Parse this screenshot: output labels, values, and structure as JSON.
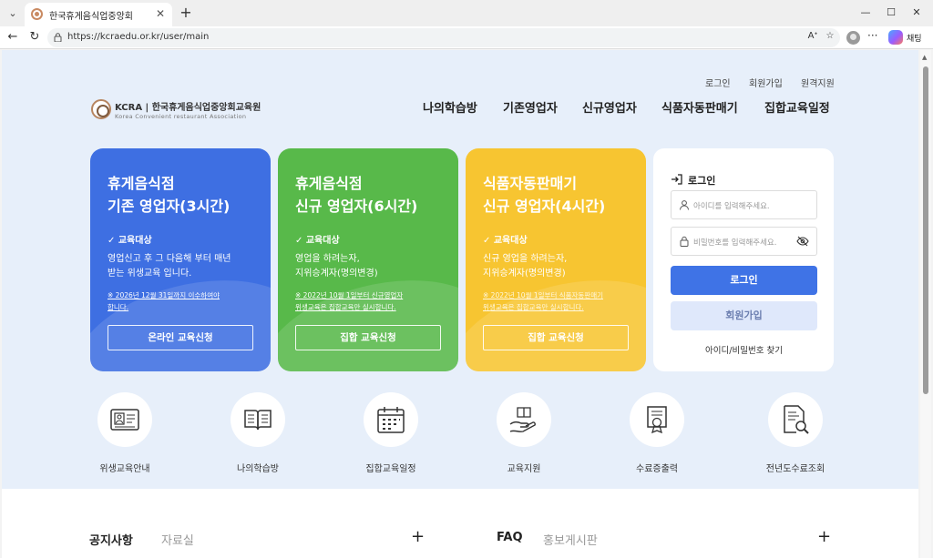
{
  "browser": {
    "tab_title": "한국휴게음식업중앙회",
    "url": "https://kcraedu.or.kr/user/main",
    "copilot_label": "채팅"
  },
  "header": {
    "util": [
      "로그인",
      "회원가입",
      "원격지원"
    ],
    "logo_main": "KCRA | 한국휴게음식업중앙회교육원",
    "logo_sub": "Korea Convenient restaurant Association",
    "nav": [
      "나의학습방",
      "기존영업자",
      "신규영업자",
      "식품자동판매기",
      "집합교육일정"
    ]
  },
  "cards": [
    {
      "title_line1": "휴게음식점",
      "title_line2": "기존 영업자(3시간)",
      "target": "✓ 교육대상",
      "desc_line1": "영업신고 후 그 다음해 부터 매년",
      "desc_line2": "받는 위생교육 입니다.",
      "note_line1": "※ 2026년 12월 31일까지 이수하여야",
      "note_line2": "합니다.",
      "button": "온라인 교육신청"
    },
    {
      "title_line1": "휴게음식점",
      "title_line2": "신규 영업자(6시간)",
      "target": "✓ 교육대상",
      "desc_line1": "영업을 하려는자,",
      "desc_line2": "지위승계자(명의변경)",
      "note_line1": "※ 2022년 10월 1일부터 신규영업자",
      "note_line2": "위생교육은 집합교육만 실시합니다.",
      "button": "집합 교육신청"
    },
    {
      "title_line1": "식품자동판매기",
      "title_line2": "신규 영업자(4시간)",
      "target": "✓ 교육대상",
      "desc_line1": "신규 영업을 하려는자,",
      "desc_line2": "지위승계자(명의변경)",
      "note_line1": "※ 2022년 10월 1일부터 식품자동판매기",
      "note_line2": "위생교육은 집합교육만 실시합니다.",
      "button": "집합 교육신청"
    }
  ],
  "login": {
    "title": "로그인",
    "id_placeholder": "아이디를 입력해주세요.",
    "pw_placeholder": "비밀번호를 입력해주세요.",
    "login_button": "로그인",
    "join_button": "회원가입",
    "find": "아이디/비밀번호 찾기"
  },
  "quick_menu": [
    {
      "label": "위생교육안내",
      "icon": "id-card-icon"
    },
    {
      "label": "나의학습방",
      "icon": "open-book-icon"
    },
    {
      "label": "집합교육일정",
      "icon": "calendar-icon"
    },
    {
      "label": "교육지원",
      "icon": "hand-book-icon"
    },
    {
      "label": "수료증출력",
      "icon": "certificate-icon"
    },
    {
      "label": "전년도수료조회",
      "icon": "document-search-icon"
    }
  ],
  "boards": {
    "left_title": "공지사항",
    "left_tab": "자료실",
    "right_title": "FAQ",
    "right_tab": "홍보게시판",
    "plus": "+"
  }
}
